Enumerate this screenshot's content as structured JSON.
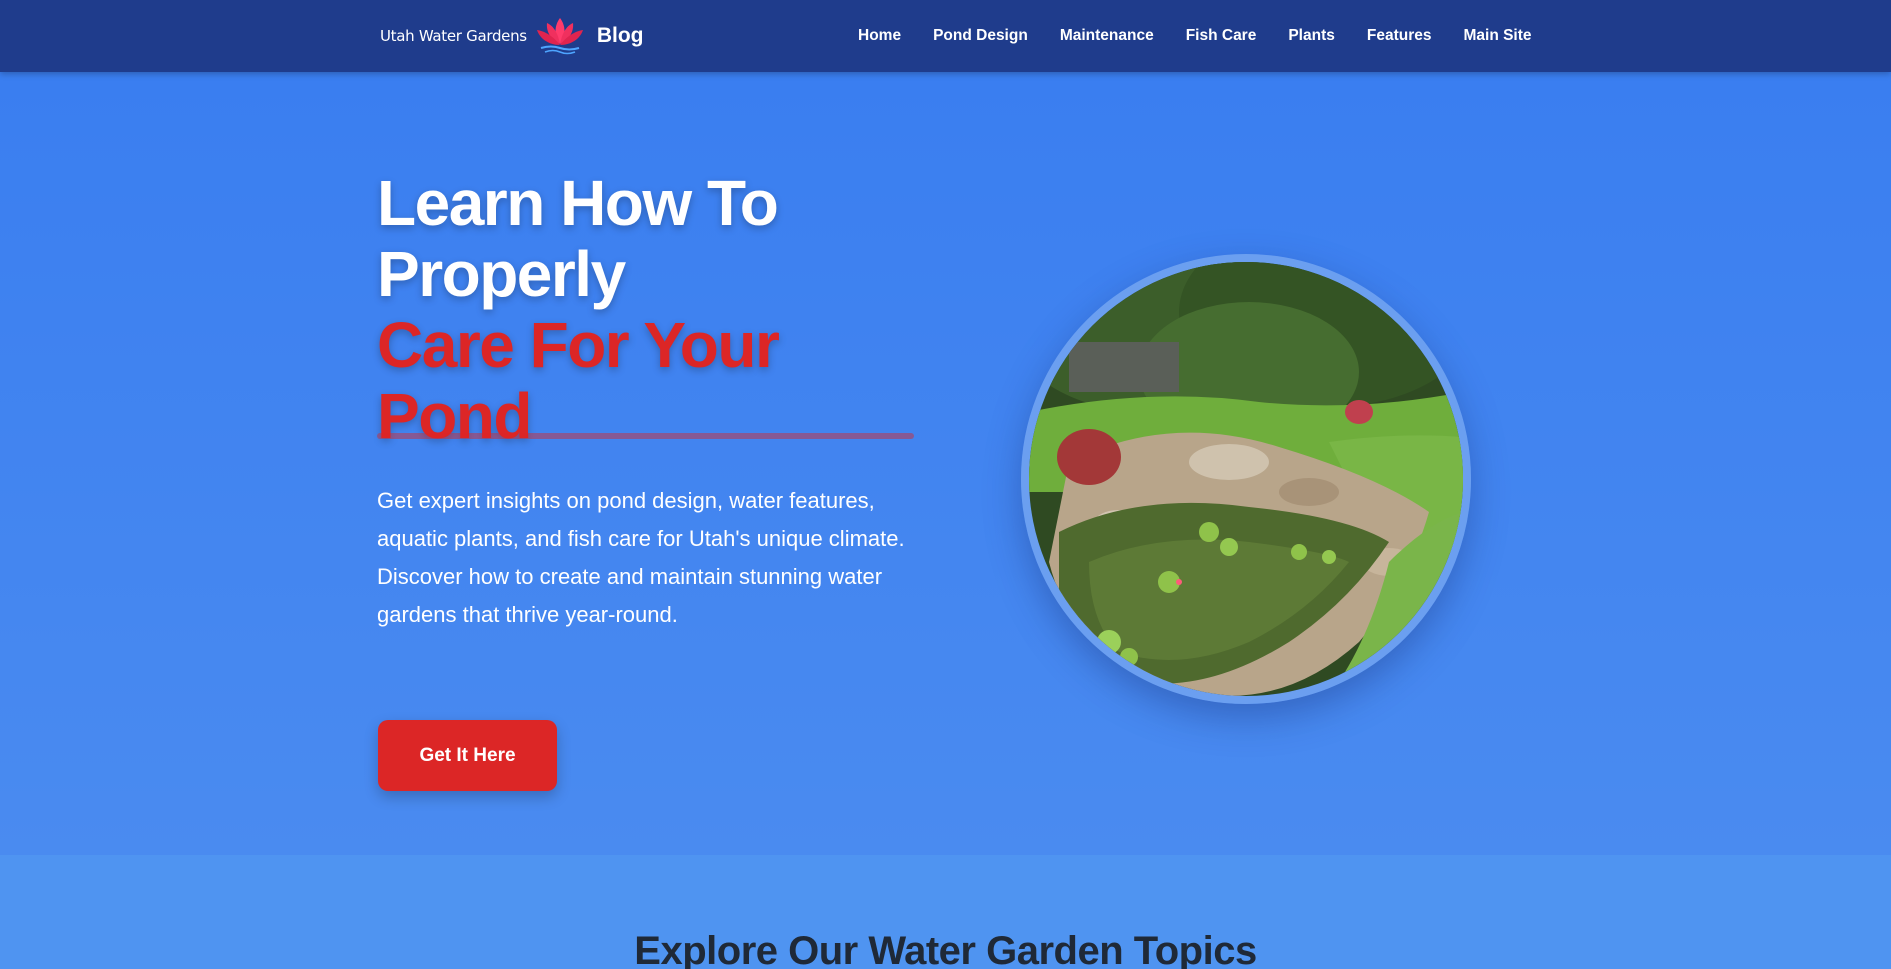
{
  "navbar": {
    "brand_wordmark": "Utah Water Gardens",
    "brand_blog": "Blog",
    "logo_icon": "lotus-icon",
    "links": [
      "Home",
      "Pond Design",
      "Maintenance",
      "Fish Care",
      "Plants",
      "Features",
      "Main Site"
    ]
  },
  "hero": {
    "title_line1": "Learn How To",
    "title_line2": "Properly",
    "title_line3": "Care For Your",
    "title_line4": "Pond",
    "description": "Get expert insights on pond design, water features, aquatic plants, and fish care for Utah's unique climate. Discover how to create and maintain stunning water gardens that thrive year-round.",
    "cta_label": "Get It Here"
  },
  "topics": {
    "heading": "Explore Our Water Garden Topics"
  },
  "colors": {
    "nav_bg": "#1f3c8c",
    "hero_bg": "#3a7ef0",
    "accent_red": "#dc2626",
    "topics_bg": "#4f94f1"
  }
}
